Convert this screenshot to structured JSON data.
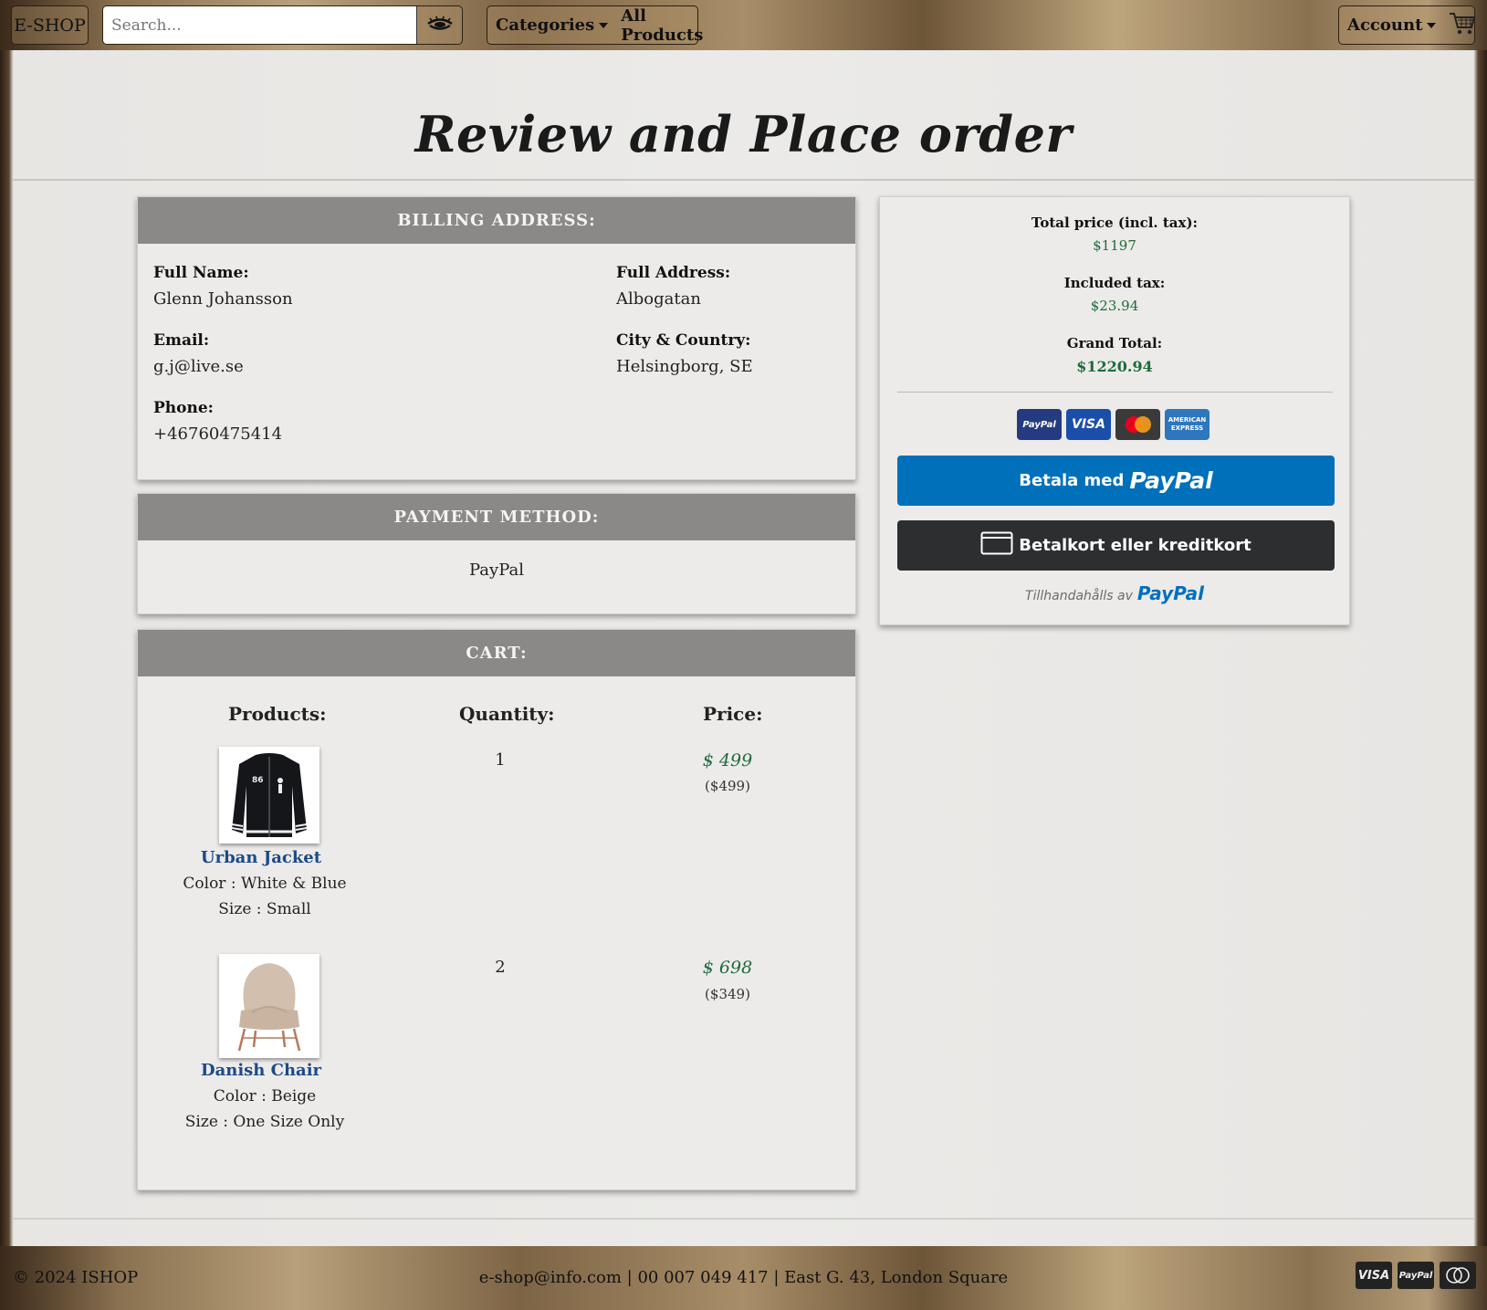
{
  "navbar": {
    "brand": "E-SHOP",
    "search_placeholder": "Search...",
    "categories_label": "Categories",
    "all_products_label": "All Products",
    "account_label": "Account"
  },
  "page_title": "Review and Place order",
  "billing": {
    "header": "BILLING ADDRESS:",
    "full_name_label": "Full Name:",
    "full_name": "Glenn Johansson",
    "email_label": "Email:",
    "email": "g.j@live.se",
    "phone_label": "Phone:",
    "phone": "+46760475414",
    "address_label": "Full Address:",
    "address": "Albogatan",
    "city_label": "City & Country:",
    "city": "Helsingborg, SE"
  },
  "payment": {
    "header": "PAYMENT METHOD:",
    "method": "PayPal"
  },
  "cart": {
    "header": "CART:",
    "col_products": "Products:",
    "col_quantity": "Quantity:",
    "col_price": "Price:",
    "items": [
      {
        "name": "Urban Jacket",
        "color": "Color : White & Blue",
        "size": "Size : Small",
        "quantity": "1",
        "price": "$ 499",
        "unit_price": "($499)"
      },
      {
        "name": "Danish Chair",
        "color": "Color : Beige",
        "size": "Size : One Size Only",
        "quantity": "2",
        "price": "$ 698",
        "unit_price": "($349)"
      }
    ]
  },
  "summary": {
    "total_label": "Total price (incl. tax):",
    "total": "$1197",
    "tax_label": "Included tax:",
    "tax": "$23.94",
    "grand_label": "Grand Total:",
    "grand": "$1220.94",
    "logos": {
      "paypal": "PayPal",
      "visa": "VISA",
      "amex_line1": "AMERICAN",
      "amex_line2": "EXPRESS"
    },
    "paypal_btn_prefix": "Betala med",
    "paypal_btn_brand": "PayPal",
    "card_btn": "Betalkort eller kreditkort",
    "powered_prefix": "Tillhandahålls av",
    "powered_brand": "PayPal"
  },
  "footer": {
    "copyright": "© 2024 ISHOP",
    "contact": "e-shop@info.com | 00 007 049 417 | East G. 43, London Square",
    "cards": {
      "visa": "VISA",
      "paypal": "PayPal"
    }
  },
  "colors": {
    "price_green": "#1f6b3a",
    "link_blue": "#1d4a86",
    "paypal_blue": "#0070ba",
    "header_grey": "#8a8987"
  }
}
